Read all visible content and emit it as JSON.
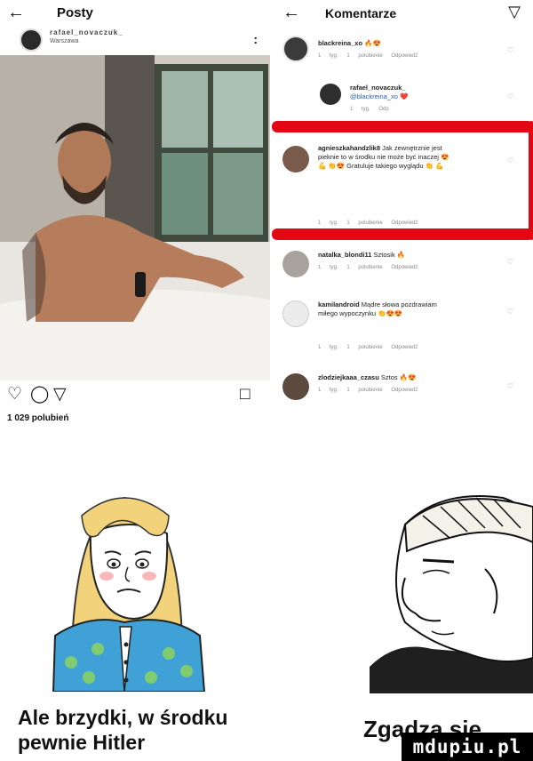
{
  "post": {
    "header": {
      "back_icon": "back-arrow-icon",
      "title": "Posty"
    },
    "account": {
      "username": "rafael_novaczuk_",
      "location": "Warszawa",
      "more": ":"
    },
    "actions": {
      "like_icon": "heart-icon",
      "comment_icon": "comment-icon",
      "share_icon": "send-icon",
      "save_icon": "bookmark-icon"
    },
    "likes": "1 029 polubień"
  },
  "comments_panel": {
    "back_icon": "back-arrow-icon",
    "title": "Komentarze",
    "send_icon": "send-icon",
    "comments": [
      {
        "user": "blackreina_xo",
        "text": "🔥😍",
        "meta": "1 tyg. 1 polubienie Odpowiedź"
      },
      {
        "user": "rafael_novaczuk_",
        "text": "@blackreina_xo ❤️",
        "meta": "1 tyg. Odp"
      },
      {
        "user": "agnieszkahandzlik8",
        "text": "Jak zewnętrznie jest pieknie to w środku nie może być inaczej 😍💪 👏😍 Gratuluje takiego wyglądu 👏 💪",
        "meta": "1 tyg. 1 polubienie Odpowiedź"
      },
      {
        "user": "natalka_blondi11",
        "text": "Sztosik 🔥",
        "meta": "1 tyg. 1 polubienie Odpowiedź"
      },
      {
        "user": "kamilandroid",
        "text": "Mądre słowa pozdrawiam miłego wypoczynku 👏😍😍",
        "meta": "1 tyg. 1 polubienie Odpowiedź"
      },
      {
        "user": "zlodziejkaaa_czasu",
        "text": "Sztos 🔥😍",
        "meta": "1 tyg. 1 polubienie Odpowiedź"
      }
    ]
  },
  "meme": {
    "caption_left_line1": "Ale brzydki, w środku",
    "caption_left_line2": "pewnie Hitler",
    "caption_right": "Zgadza się",
    "watermark": "mdupiu.pl"
  },
  "colors": {
    "highlight": "#e30613",
    "meta_text": "#8a8a8a",
    "watermark_bg": "#000000"
  }
}
